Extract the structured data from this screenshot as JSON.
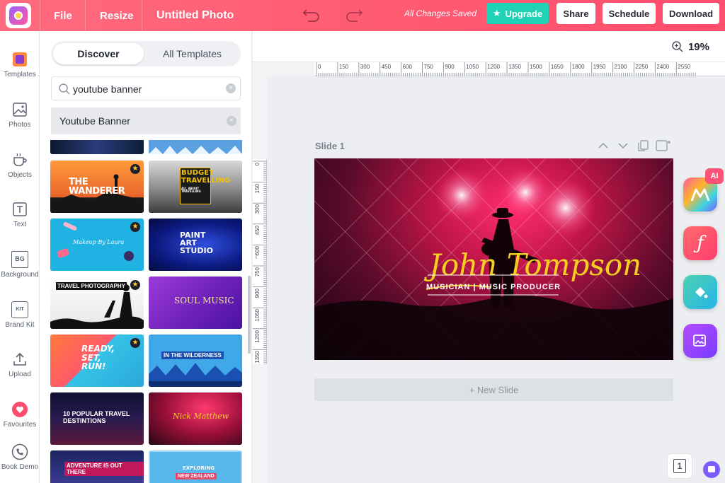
{
  "topbar": {
    "file": "File",
    "resize": "Resize",
    "doc_title": "Untitled Photo",
    "saved": "All Changes Saved",
    "upgrade": "Upgrade",
    "share": "Share",
    "schedule": "Schedule",
    "download": "Download"
  },
  "rail": {
    "templates": "Templates",
    "photos": "Photos",
    "objects": "Objects",
    "text": "Text",
    "background": "Background",
    "background_icon_text": "BG",
    "brand_kit": "Brand Kit",
    "brand_kit_icon_text": "KIT",
    "upload": "Upload",
    "favourites": "Favourites",
    "book_demo": "Book Demo"
  },
  "panel": {
    "tab_discover": "Discover",
    "tab_all": "All Templates",
    "search_value": "youtube banner",
    "suggestion": "Youtube Banner",
    "thumbs": [
      {
        "text": "THE WANDERER",
        "sub": "",
        "premium": true
      },
      {
        "text": "BUDGET TRAVELLING",
        "sub": "ALL ABOUT TRAVELLING",
        "premium": false
      },
      {
        "text": "Makeup By Laura",
        "sub": "",
        "premium": true
      },
      {
        "text": "PAINT ART STUDIO",
        "sub": "",
        "premium": false
      },
      {
        "text": "TRAVEL PHOTOGRAPHY",
        "sub": "",
        "premium": true
      },
      {
        "text": "SOUL MUSIC",
        "sub": "",
        "premium": false
      },
      {
        "text": "READY, SET, RUN!",
        "sub": "",
        "premium": true
      },
      {
        "text": "IN THE WILDERNESS",
        "sub": "",
        "premium": false
      },
      {
        "text": "10 POPULAR TRAVEL DESTINTIONS",
        "sub": "",
        "premium": false
      },
      {
        "text": "Nick Matthew",
        "sub": "",
        "premium": false
      },
      {
        "text": "ADVENTURE IS OUT THERE",
        "sub": "",
        "premium": false
      },
      {
        "text": "EXPLORING",
        "sub": "NEW ZEALAND",
        "premium": false
      }
    ]
  },
  "workspace": {
    "zoom": "19%",
    "slide_label": "Slide 1",
    "new_slide": "+ New Slide",
    "pages_count": "1",
    "ai_badge": "AI",
    "ruler_h": [
      "0",
      "150",
      "300",
      "450",
      "600",
      "750",
      "900",
      "1050",
      "1200",
      "1350",
      "1500",
      "1650",
      "1800",
      "1950",
      "2100",
      "2250",
      "2400",
      "2550"
    ],
    "ruler_v": [
      "0",
      "150",
      "300",
      "450",
      "600",
      "750",
      "900",
      "1050",
      "1200",
      "1350"
    ]
  },
  "slide": {
    "name": "John Tompson",
    "tagline": "MUSICIAN | MUSIC PRODUCER"
  },
  "colors": {
    "topbar": "#ff5a72",
    "upgrade": "#1fd1b5",
    "accent_gold": "#f5d020"
  }
}
